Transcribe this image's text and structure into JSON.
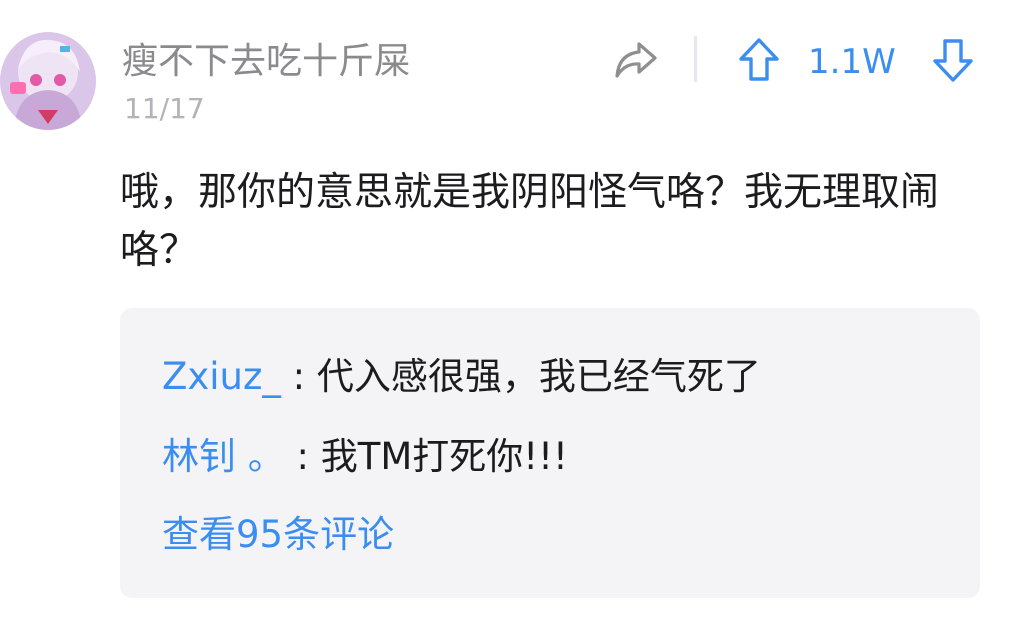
{
  "comment": {
    "username": "瘦不下去吃十斤屎",
    "date": "11/17",
    "body": "哦，那你的意思就是我阴阳怪气咯？我无理取闹咯？",
    "vote_count": "1.1W"
  },
  "icons": {
    "share": "share-icon",
    "upvote": "arrow-up-icon",
    "downvote": "arrow-down-icon"
  },
  "replies": [
    {
      "author": "Zxiuz_",
      "separator": ":",
      "text": "代入感很强，我已经气死了"
    },
    {
      "author": "林钊 。",
      "separator": ":",
      "text": "我TM打死你!!!"
    }
  ],
  "view_all_label": "查看95条评论",
  "colors": {
    "accent": "#3b8ef0",
    "muted_text": "#8a8a8f",
    "body_text": "#1c1c1e",
    "reply_bg": "#f4f4f6"
  }
}
